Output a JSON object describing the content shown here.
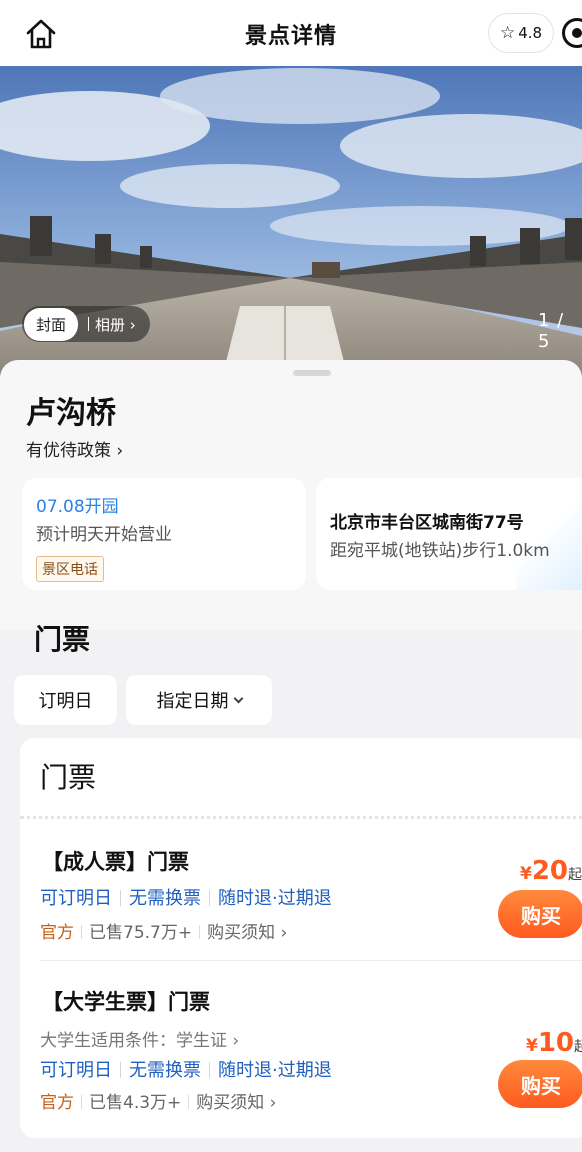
{
  "header": {
    "title": "景点详情",
    "rating": "4.8"
  },
  "hero": {
    "cover_label": "封面",
    "album_label": "相册",
    "counter": "1 / 5"
  },
  "spot": {
    "name": "卢沟桥",
    "discount_link": "有优待政策"
  },
  "hours_card": {
    "open_date": "07.08开园",
    "note": "预计明天开始营业",
    "phone_tag": "景区电话"
  },
  "address_card": {
    "address": "北京市丰台区城南街77号",
    "distance": "距宛平城(地铁站)步行1.0km"
  },
  "tickets": {
    "section_title": "门票",
    "date_chips": [
      "订明日",
      "指定日期"
    ],
    "panel_title": "门票",
    "items": [
      {
        "name": "【成人票】门票",
        "condition": "",
        "features": [
          "可订明日",
          "无需换票",
          "随时退·过期退"
        ],
        "official": "官方",
        "sold": "已售75.7万+",
        "notice": "购买须知",
        "price_symbol": "¥",
        "price": "20",
        "price_suffix": "起",
        "buy_label": "购买"
      },
      {
        "name": "【大学生票】门票",
        "condition": "大学生适用条件：学生证",
        "features": [
          "可订明日",
          "无需换票",
          "随时退·过期退"
        ],
        "official": "官方",
        "sold": "已售4.3万+",
        "notice": "购买须知",
        "price_symbol": "¥",
        "price": "10",
        "price_suffix": "起",
        "buy_label": "购买"
      }
    ]
  },
  "colors": {
    "accent_orange": "#ff5a1f",
    "link_blue": "#1f5fbf",
    "date_blue": "#2b82e6"
  }
}
